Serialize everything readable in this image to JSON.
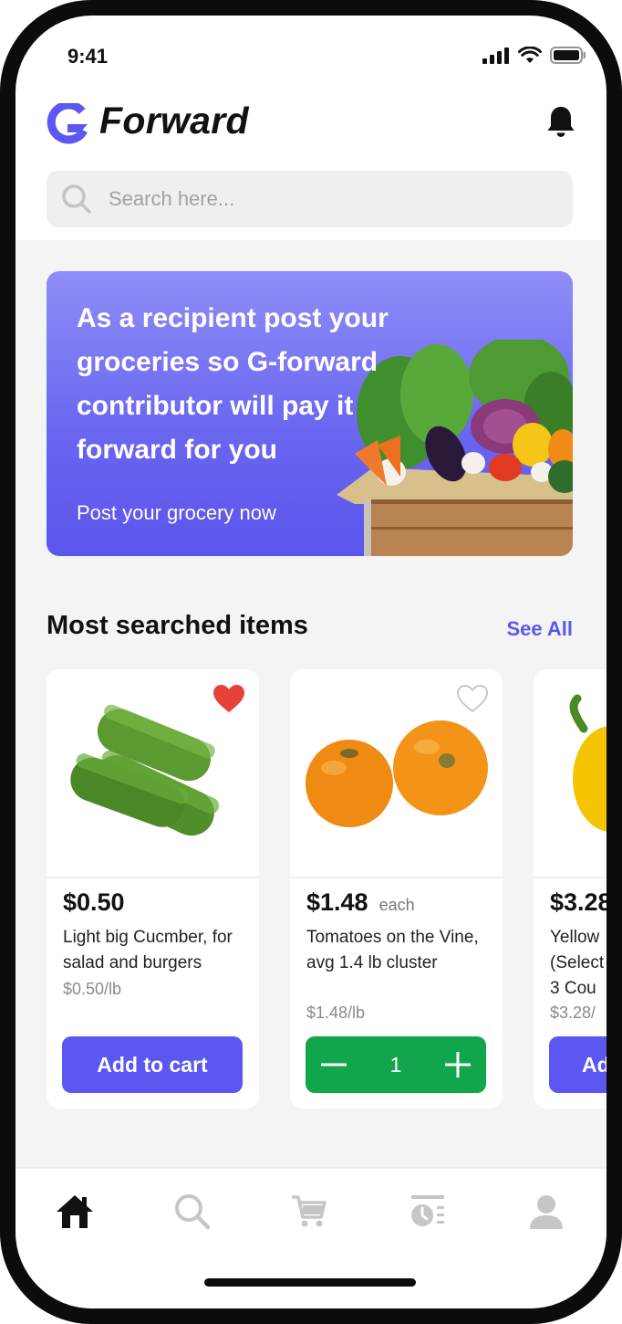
{
  "status_bar": {
    "time": "9:41"
  },
  "header": {
    "brand": "Forward"
  },
  "search": {
    "placeholder": "Search here..."
  },
  "banner": {
    "text": "As a recipient post your groceries so G-forward contributor will pay it forward for you",
    "cta": "Post your grocery now"
  },
  "section": {
    "title": "Most searched items",
    "see_all": "See All"
  },
  "products": [
    {
      "price": "$0.50",
      "price_unit": "",
      "name": "Light big Cucmber, for salad and burgers",
      "unit_price": "$0.50/lb",
      "favorite": true,
      "action": "Add to cart"
    },
    {
      "price": "$1.48",
      "price_unit": "each",
      "name": "Tomatoes on the Vine, avg 1.4 lb cluster",
      "unit_price": "$1.48/lb",
      "favorite": false,
      "quantity": "1"
    },
    {
      "price": "$3.28",
      "price_unit": "",
      "name": "Yellow (Select 3 Cou",
      "unit_price": "$3.28/",
      "action": "Ad"
    }
  ],
  "nav": {
    "items": [
      "home-icon",
      "search-icon",
      "cart-icon",
      "history-icon",
      "profile-icon"
    ],
    "active": "home-icon"
  },
  "colors": {
    "accent": "#5b57f0",
    "green": "#12a64c",
    "heart": "#e8413a"
  }
}
